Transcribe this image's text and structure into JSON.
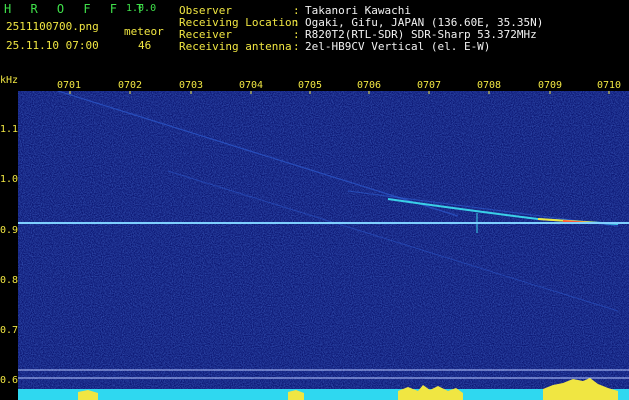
{
  "header": {
    "app_name": "H R O F F T",
    "app_version": "1.0.0",
    "file_name": "2511100700.png",
    "timestamp": "25.11.10 07:00",
    "meteor_label": "meteor",
    "meteor_count": "46",
    "info_rows": [
      {
        "label": "Observer",
        "sep": ":",
        "value": "Takanori Kawachi"
      },
      {
        "label": "Receiving Location",
        "sep": ":",
        "value": "Ogaki, Gifu, JAPAN (136.60E, 35.35N)"
      },
      {
        "label": "Receiver",
        "sep": ":",
        "value": "R820T2(RTL-SDR) SDR-Sharp 53.372MHz"
      },
      {
        "label": "Receiving antenna",
        "sep": ":",
        "value": "2el-HB9CV Vertical (el. E-W)"
      }
    ]
  },
  "axis": {
    "unit": "kHz",
    "y_ticks": [
      "1.1",
      "1.0",
      "0.9",
      "0.8",
      "0.7",
      "0.6"
    ],
    "x_ticks": [
      "0701",
      "0702",
      "0703",
      "0704",
      "0705",
      "0706",
      "0707",
      "0708",
      "0709",
      "0710"
    ]
  },
  "colors": {
    "background": "#000000",
    "spectrum_bg": "#0a1470",
    "app_green": "#3fe04a",
    "label_yellow": "#f0e642",
    "noise_floor": "#2fd8f0",
    "carrier": "#7fd0ff"
  }
}
